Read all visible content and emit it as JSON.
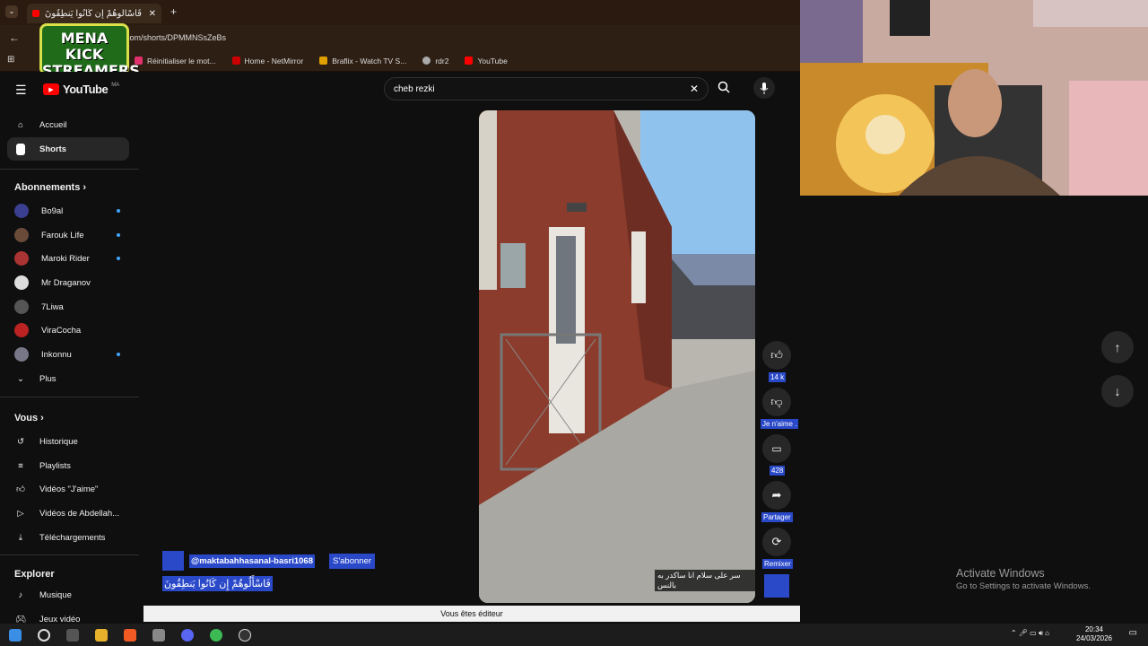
{
  "browser": {
    "tab_title": "فَاسْأَلُوهُمْ إِن كَانُوا يَنطِقُونَ",
    "url": "com/shorts/DPMMNSsZeBs",
    "bookmarks": [
      {
        "label": "Réinitialiser le mot...",
        "color": "#e1306c"
      },
      {
        "label": "Home - NetMirror",
        "color": "#c00"
      },
      {
        "label": "Braflix - Watch TV S...",
        "color": "#e0a000"
      },
      {
        "label": "rdr2",
        "color": "#aaa"
      },
      {
        "label": "YouTube",
        "color": "#f00"
      }
    ]
  },
  "overlay_logo": {
    "line1": "MENA KICK",
    "line2": "STREAMERS"
  },
  "youtube": {
    "logo_text": "YouTube",
    "region": "MA",
    "search_value": "cheb rezki",
    "nav": [
      {
        "label": "Accueil",
        "icon": "home-icon"
      },
      {
        "label": "Shorts",
        "icon": "shorts-icon"
      }
    ],
    "subscriptions_heading": "Abonnements",
    "subscriptions": [
      {
        "label": "Bo9al",
        "color": "#3b3f8f",
        "dot": true
      },
      {
        "label": "Farouk Life",
        "color": "#6a4b3a",
        "dot": true
      },
      {
        "label": "Maroki Rider",
        "color": "#a33",
        "dot": true
      },
      {
        "label": "Mr Draganov",
        "color": "#ddd",
        "dot": false
      },
      {
        "label": "7Liwa",
        "color": "#555",
        "dot": false
      },
      {
        "label": "ViraCocha",
        "color": "#b22",
        "dot": false
      },
      {
        "label": "Inkonnu",
        "color": "#778",
        "dot": true
      }
    ],
    "more_label": "Plus",
    "you_heading": "Vous",
    "you_items": [
      {
        "label": "Historique",
        "icon": "history-icon"
      },
      {
        "label": "Playlists",
        "icon": "playlist-icon"
      },
      {
        "label": "Vidéos \"J'aime\"",
        "icon": "thumbs-up-icon"
      },
      {
        "label": "Vidéos de Abdellah...",
        "icon": "video-icon"
      },
      {
        "label": "Téléchargements",
        "icon": "download-icon"
      }
    ],
    "explore_heading": "Explorer",
    "explore_items": [
      {
        "label": "Musique",
        "icon": "music-icon"
      },
      {
        "label": "Jeux vidéo",
        "icon": "gamepad-icon"
      }
    ],
    "short": {
      "channel": "@maktabahhasanal-basri1068",
      "subscribe_label": "S'abonner",
      "title": "فَاسْأَلُوهُمْ إِن كَانُوا يَنطِقُونَ",
      "caption": "سر على سلام انا ساكدر به بالنس",
      "likes": "14 k",
      "dislike_label": "Je n'aime .",
      "comments": "428",
      "share_label": "Partager",
      "remix_label": "Remixer"
    },
    "editor_notice": "Vous êtes éditeur"
  },
  "windows": {
    "activate_title": "Activate Windows",
    "activate_sub": "Go to Settings to activate Windows.",
    "time": "20:34",
    "date": "24/03/2026"
  }
}
